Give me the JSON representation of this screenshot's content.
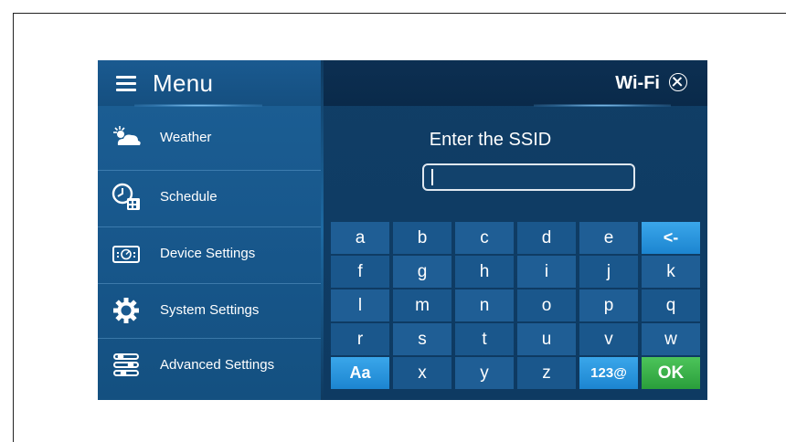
{
  "menu": {
    "title": "Menu",
    "items": [
      {
        "label": "Weather",
        "icon": "weather-cloud-sun-icon"
      },
      {
        "label": "Schedule",
        "icon": "schedule-clock-icon"
      },
      {
        "label": "Device Settings",
        "icon": "device-settings-icon"
      },
      {
        "label": "System Settings",
        "icon": "gear-icon"
      },
      {
        "label": "Advanced Settings",
        "icon": "sliders-icon"
      }
    ]
  },
  "wifi": {
    "title": "Wi-Fi",
    "close_icon": "close-circle-icon",
    "prompt": "Enter the SSID",
    "ssid_value": ""
  },
  "keyboard": {
    "rows": [
      [
        "a",
        "b",
        "c",
        "d",
        "e",
        "<-"
      ],
      [
        "f",
        "g",
        "h",
        "i",
        "j",
        "k"
      ],
      [
        "l",
        "m",
        "n",
        "o",
        "p",
        "q"
      ],
      [
        "r",
        "s",
        "t",
        "u",
        "v",
        "w"
      ],
      [
        "Aa",
        "x",
        "y",
        "z",
        "123@",
        "OK"
      ]
    ]
  },
  "colors": {
    "accent_blue": "#2a97e0",
    "ok_green": "#36b04a",
    "panel_bg": "#0e3a62",
    "sidebar_bg": "#1a5a90"
  }
}
